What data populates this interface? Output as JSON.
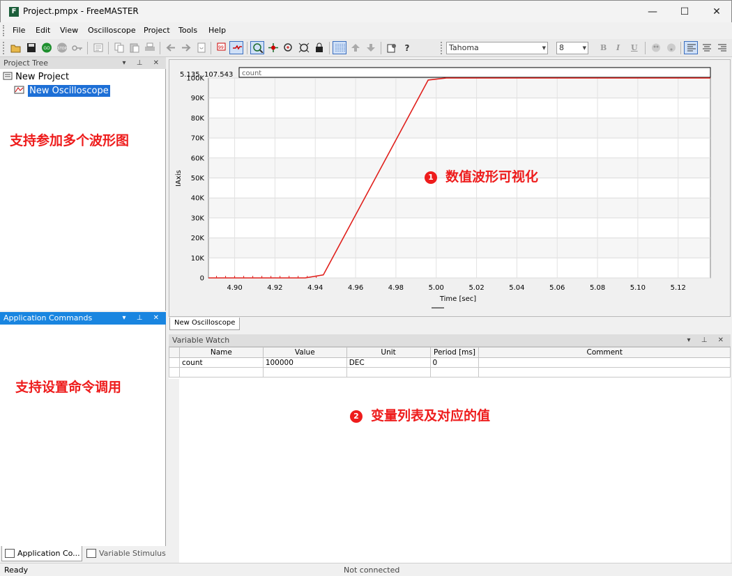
{
  "window": {
    "title": "Project.pmpx - FreeMASTER",
    "app_icon_letter": "F",
    "minimize": "—",
    "maximize": "☐",
    "close": "✕"
  },
  "menu": [
    "File",
    "Edit",
    "View",
    "Oscilloscope",
    "Project",
    "Tools",
    "Help"
  ],
  "toolbar": {
    "font_name": "Tahoma",
    "font_size": "8",
    "bold": "B",
    "italic": "I",
    "underline": "U"
  },
  "project_tree": {
    "header": "Project Tree",
    "root": "New Project",
    "child": "New Oscilloscope"
  },
  "app_commands": {
    "header": "Application Commands"
  },
  "bottom_tabs": [
    "Application Co...",
    "Variable Stimulus"
  ],
  "annotations": {
    "tree_note": "支持参加多个波形图",
    "cmd_note": "支持设置命令调用",
    "scope_note": "数值波形可视化",
    "scope_num": "1",
    "watch_note": "变量列表及对应的值",
    "watch_num": "2"
  },
  "scope": {
    "cursor_readout": "5.135, 107.543",
    "tab_label": "New Oscilloscope"
  },
  "chart_data": {
    "type": "line",
    "xlabel": "Time [sec]",
    "ylabel": "IAxis",
    "xlim": [
      4.887,
      5.136
    ],
    "ylim": [
      0,
      100000
    ],
    "x_ticks": [
      4.9,
      4.92,
      4.94,
      4.96,
      4.98,
      5.0,
      5.02,
      5.04,
      5.06,
      5.08,
      5.1,
      5.12
    ],
    "x_tick_labels": [
      "4.90",
      "4.92",
      "4.94",
      "4.96",
      "4.98",
      "5.00",
      "5.02",
      "5.04",
      "5.06",
      "5.08",
      "5.10",
      "5.12"
    ],
    "y_ticks": [
      0,
      10000,
      20000,
      30000,
      40000,
      50000,
      60000,
      70000,
      80000,
      90000,
      100000
    ],
    "y_tick_labels": [
      "0",
      "10K",
      "20K",
      "30K",
      "40K",
      "50K",
      "60K",
      "70K",
      "80K",
      "90K",
      "100K"
    ],
    "grid": true,
    "legend": "top",
    "series": [
      {
        "name": "count",
        "color": "#e0201c",
        "x": [
          4.887,
          4.935,
          4.944,
          4.996,
          5.005,
          5.136
        ],
        "y": [
          0,
          0,
          1500,
          99000,
          100000,
          100000
        ]
      }
    ]
  },
  "variable_watch": {
    "header": "Variable Watch",
    "columns": [
      "Name",
      "Value",
      "Unit",
      "Period [ms]",
      "Comment"
    ],
    "rows": [
      [
        "count",
        "100000",
        "DEC",
        "0",
        ""
      ],
      [
        "",
        "",
        "",
        "",
        ""
      ]
    ]
  },
  "status": {
    "left": "Ready",
    "center": "Not connected"
  },
  "colors": {
    "accent": "#1985e0",
    "annotation": "#ee1c1c",
    "trace": "#e0201c"
  }
}
